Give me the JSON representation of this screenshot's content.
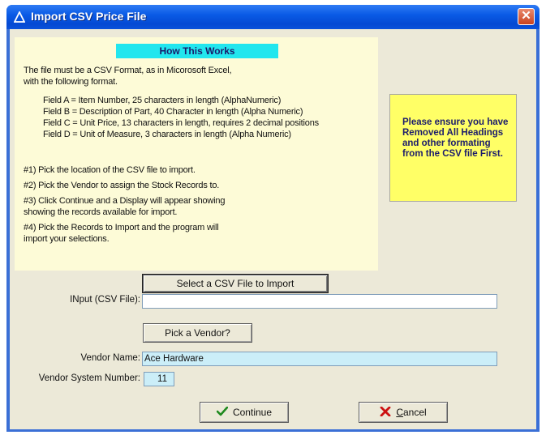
{
  "window": {
    "title": "Import CSV Price File"
  },
  "info": {
    "header": "How This Works",
    "intro_line1": "The file must be a CSV Format, as in Micorosoft Excel,",
    "intro_line2": "with the following format.",
    "field_a": "Field A = Item Number, 25 characters in length (AlphaNumeric)",
    "field_b": "Field B = Description of Part, 40 Character in length (Alpha Numeric)",
    "field_c": "Field C = Unit Price, 13 characters in length, requires 2 decimal positions",
    "field_d": "Field D = Unit of Measure, 3 characters in length (Alpha Numeric)",
    "step1": "#1) Pick the location of the CSV file to import.",
    "step2": "#2) Pick the Vendor to assign the Stock Records to.",
    "step3_line1": "#3) Click Continue and a Display will appear showing",
    "step3_line2": "showing the records available for import.",
    "step4_line1": "#4) Pick the Records to Import and the program will",
    "step4_line2": "import your selections."
  },
  "warning": {
    "text": "Please ensure you have Removed All Headings and other formating from the CSV file First."
  },
  "form": {
    "select_csv_button": "Select a CSV File to Import",
    "input_label": "INput (CSV File):",
    "input_value": "",
    "pick_vendor_button": "Pick a Vendor?",
    "vendor_name_label": "Vendor Name:",
    "vendor_name_value": "Ace Hardware",
    "vendor_system_label": "Vendor System Number:",
    "vendor_system_value": "11"
  },
  "buttons": {
    "continue": "Continue",
    "cancel_rest": "ancel",
    "cancel_underlined": "C"
  },
  "colors": {
    "title_bar": "#0a5be6",
    "info_panel": "#fdfbd7",
    "header_cyan": "#22e6ee",
    "warning_yellow": "#ffff66",
    "vendor_field": "#cbeef8",
    "close_red": "#c9421f"
  }
}
